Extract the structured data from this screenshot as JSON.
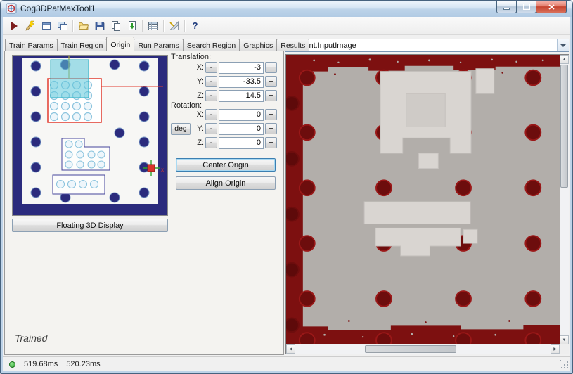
{
  "window": {
    "title": "Cog3DPatMaxTool1"
  },
  "toolbar": {
    "help_glyph": "?",
    "icons": [
      "run-icon",
      "electric-edit-icon",
      "floating-display-icon",
      "image-display-icon",
      "open-icon",
      "save-icon",
      "copy-icon",
      "paste-icon",
      "results-grid-icon",
      "calibration-icon",
      "help-icon"
    ]
  },
  "tabs": {
    "items": [
      "Train Params",
      "Train Region",
      "Origin",
      "Run Params",
      "Search Region",
      "Graphics",
      "Results"
    ],
    "active": "Origin"
  },
  "origin_page": {
    "translation": {
      "label": "Translation:",
      "rows": [
        {
          "axis": "X:",
          "value": "-3"
        },
        {
          "axis": "Y:",
          "value": "-33.5"
        },
        {
          "axis": "Z:",
          "value": "14.5"
        }
      ]
    },
    "rotation": {
      "label": "Rotation:",
      "unit_button": "deg",
      "rows": [
        {
          "axis": "X:",
          "value": "0"
        },
        {
          "axis": "Y:",
          "value": "0"
        },
        {
          "axis": "Z:",
          "value": "0"
        }
      ]
    },
    "spinner": {
      "minus": "-",
      "plus": "+"
    },
    "center_button": "Center Origin",
    "align_button": "Align Origin",
    "floating_button": "Floating 3D Display",
    "train_status": "Trained",
    "axis_marker_label": "x"
  },
  "right_panel": {
    "image_selector": "Current.InputImage"
  },
  "status_bar": {
    "time1": "519.68ms",
    "time2": "520.23ms"
  },
  "colors": {
    "view3d_background": "#2b2b7d",
    "selection_outline": "#e23b2e",
    "overlay_teal": "#53c6d8",
    "image_background": "#7d1010",
    "image_gray": "#b2aeaa",
    "status_green": "#3cb13c"
  }
}
